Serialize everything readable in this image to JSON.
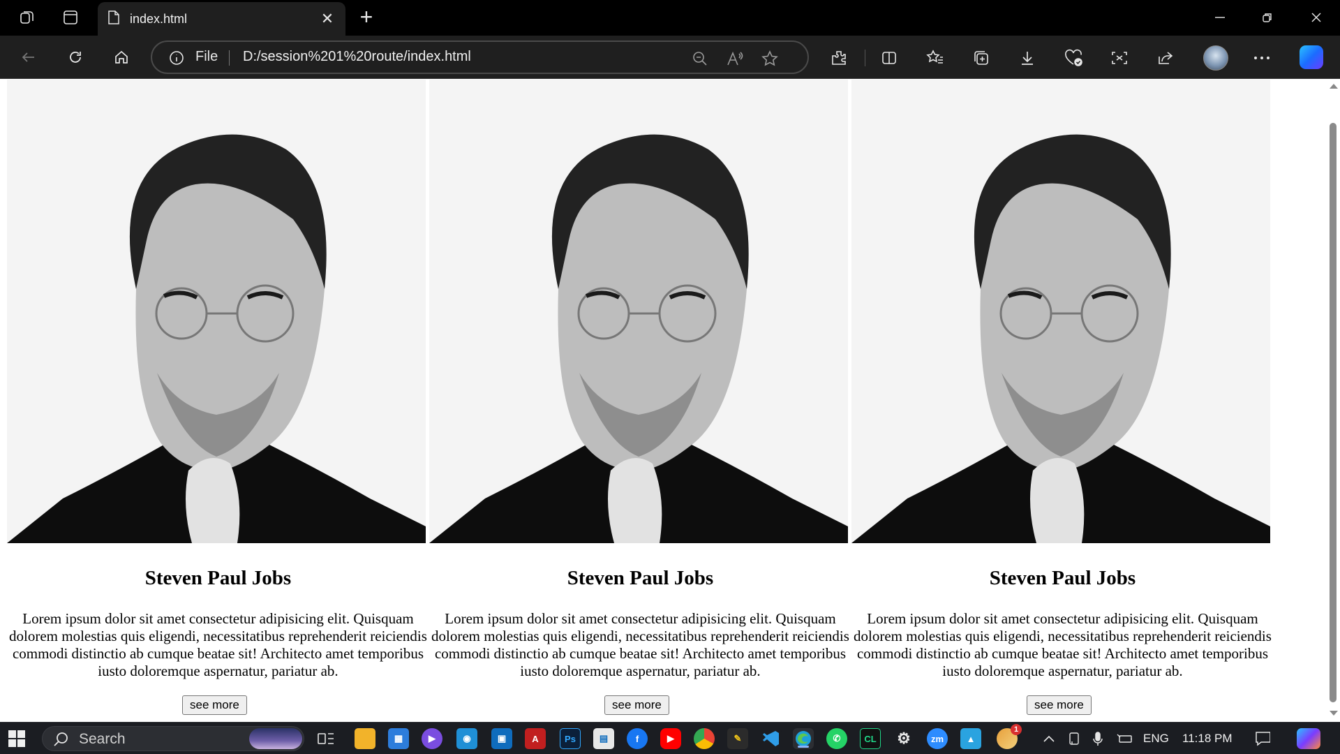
{
  "browser": {
    "tab": {
      "title": "index.html"
    },
    "address": {
      "scheme": "File",
      "url": "D:/session%201%20route/index.html"
    }
  },
  "page": {
    "cards": [
      {
        "name": "Steven Paul Jobs",
        "text": "Lorem ipsum dolor sit amet consectetur adipisicing elit. Quisquam dolorem molestias quis eligendi, necessitatibus reprehenderit reiciendis commodi distinctio ab cumque beatae sit! Architecto amet temporibus iusto doloremque aspernatur, pariatur ab.",
        "button": "see more"
      },
      {
        "name": "Steven Paul Jobs",
        "text": "Lorem ipsum dolor sit amet consectetur adipisicing elit. Quisquam dolorem molestias quis eligendi, necessitatibus reprehenderit reiciendis commodi distinctio ab cumque beatae sit! Architecto amet temporibus iusto doloremque aspernatur, pariatur ab.",
        "button": "see more"
      },
      {
        "name": "Steven Paul Jobs",
        "text": "Lorem ipsum dolor sit amet consectetur adipisicing elit. Quisquam dolorem molestias quis eligendi, necessitatibus reprehenderit reiciendis commodi distinctio ab cumque beatae sit! Architecto amet temporibus iusto doloremque aspernatur, pariatur ab.",
        "button": "see more"
      }
    ]
  },
  "taskbar": {
    "search_label": "Search",
    "language": "ENG",
    "time": "11:18 PM",
    "badge_count": "1"
  },
  "colors": {
    "titlebar": "#000000",
    "toolbar": "#1f1f1f",
    "taskbar": "#1b1d22",
    "accent": "#8ab4f8"
  }
}
